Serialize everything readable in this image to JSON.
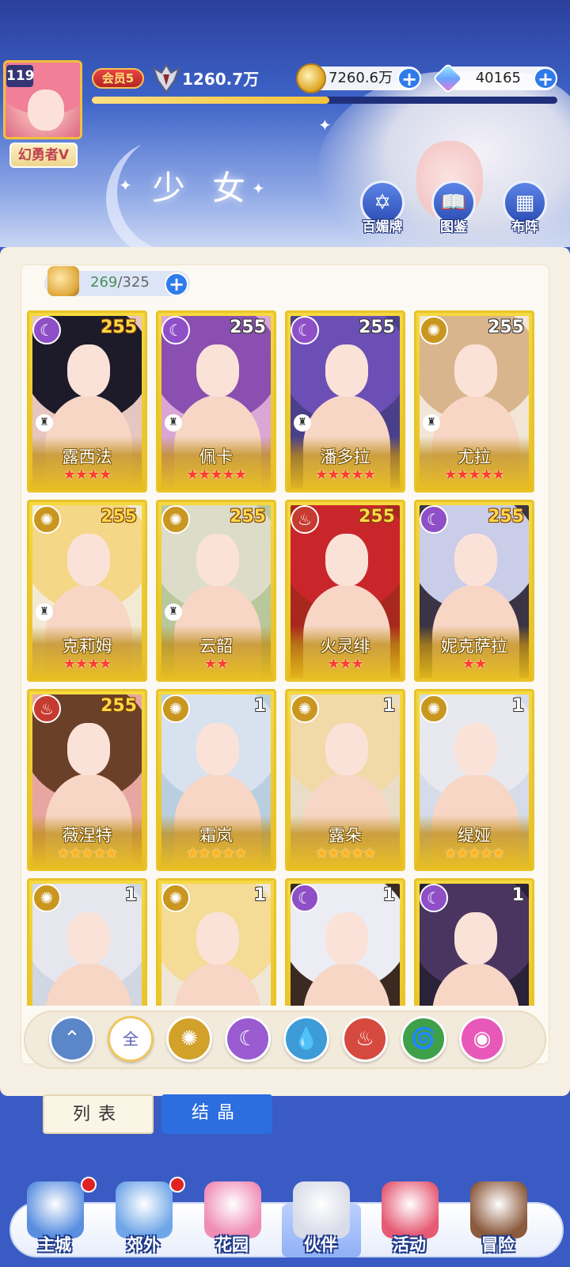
{
  "header": {
    "level": "119",
    "title_badge": "幻勇者V",
    "vip": "会员5",
    "power": "1260.7万",
    "exp_fraction": 0.51,
    "gold": "7260.6万",
    "gems": "40165",
    "page_title": "少女",
    "buttons": [
      {
        "label": "百媚牌",
        "icon": "card-icon"
      },
      {
        "label": "图鉴",
        "icon": "book-icon"
      },
      {
        "label": "布阵",
        "icon": "grid-icon"
      }
    ]
  },
  "roster": {
    "count": "269",
    "total": "/325",
    "cards": [
      {
        "name": "露西法",
        "level": "255",
        "element": "moon",
        "stars": "★★★★",
        "star_color": "red",
        "max": true,
        "rook": true,
        "hair": "#1d1a2a",
        "bg": "#e6c6c0"
      },
      {
        "name": "佩卡",
        "level": "255",
        "element": "moon",
        "stars": "★★★★★",
        "star_color": "red",
        "max": false,
        "rook": true,
        "hair": "#8a4fb0",
        "bg": "#d9a6d6"
      },
      {
        "name": "潘多拉",
        "level": "255",
        "element": "moon",
        "stars": "★★★★★",
        "star_color": "red",
        "max": false,
        "rook": true,
        "hair": "#6b4fb5",
        "bg": "#4a3f8a"
      },
      {
        "name": "尤拉",
        "level": "255",
        "element": "sun",
        "stars": "★★★★★",
        "star_color": "red",
        "max": false,
        "rook": true,
        "hair": "#d8b58c",
        "bg": "#f1e6d8"
      },
      {
        "name": "克莉姆",
        "level": "255",
        "element": "sun",
        "stars": "★★★★",
        "star_color": "red",
        "max": true,
        "rook": true,
        "hair": "#f4d787",
        "bg": "#f3ead6"
      },
      {
        "name": "云韶",
        "level": "255",
        "element": "sun",
        "stars": "★★",
        "star_color": "red",
        "max": true,
        "rook": true,
        "hair": "#dcdcc8",
        "bg": "#b8c79c"
      },
      {
        "name": "火灵绯",
        "level": "255",
        "element": "fire",
        "stars": "★★★",
        "star_color": "red",
        "max": true,
        "rook": false,
        "hair": "#c9262b",
        "bg": "#a8271e"
      },
      {
        "name": "妮克萨拉",
        "level": "255",
        "element": "moon",
        "stars": "★★",
        "star_color": "red",
        "max": true,
        "rook": false,
        "hair": "#c9cde8",
        "bg": "#3a3445"
      },
      {
        "name": "薇涅特",
        "level": "255",
        "element": "fire",
        "stars": "★★★★★",
        "star_color": "gold",
        "max": true,
        "rook": false,
        "hair": "#6b4028",
        "bg": "#e8a6a2"
      },
      {
        "name": "霜岚",
        "level": "1",
        "element": "sun",
        "stars": "★★★★★",
        "star_color": "gold",
        "max": false,
        "rook": false,
        "hair": "#d8e2ef",
        "bg": "#b9cfe0"
      },
      {
        "name": "露朵",
        "level": "1",
        "element": "sun",
        "stars": "★★★★★",
        "star_color": "gold",
        "max": false,
        "rook": false,
        "hair": "#f2d9a8",
        "bg": "#eaddc8"
      },
      {
        "name": "缇娅",
        "level": "1",
        "element": "sun",
        "stars": "★★★★★",
        "star_color": "gold",
        "max": false,
        "rook": false,
        "hair": "#e8e8ef",
        "bg": "#d5dbe8"
      },
      {
        "name": "",
        "level": "1",
        "element": "sun",
        "stars": "",
        "star_color": "gold",
        "max": false,
        "rook": false,
        "hair": "#e6e6ee",
        "bg": "#d0d6e2"
      },
      {
        "name": "",
        "level": "1",
        "element": "sun",
        "stars": "",
        "star_color": "gold",
        "max": false,
        "rook": false,
        "hair": "#f4db96",
        "bg": "#f0e6d6"
      },
      {
        "name": "",
        "level": "1",
        "element": "moon",
        "stars": "",
        "star_color": "gold",
        "max": false,
        "rook": false,
        "hair": "#ececf4",
        "bg": "#3a2a22"
      },
      {
        "name": "",
        "level": "1",
        "element": "moon",
        "stars": "",
        "star_color": "gold",
        "max": false,
        "rook": false,
        "hair": "#4a3560",
        "bg": "#2a2238"
      }
    ]
  },
  "filters": [
    {
      "id": "wing",
      "glyph": "⌃",
      "color": "#5b86c8"
    },
    {
      "id": "all",
      "glyph": "全",
      "color": "#ffffff"
    },
    {
      "id": "sun",
      "glyph": "✺",
      "color": "#d1a12a"
    },
    {
      "id": "moon",
      "glyph": "☾",
      "color": "#9a5bd0"
    },
    {
      "id": "water",
      "glyph": "💧",
      "color": "#3d9bd8"
    },
    {
      "id": "fire",
      "glyph": "♨",
      "color": "#d6493e"
    },
    {
      "id": "wind",
      "glyph": "🌀",
      "color": "#3fa04a"
    },
    {
      "id": "charm",
      "glyph": "◉",
      "color": "#e858b8"
    }
  ],
  "tabs": {
    "list": "列表",
    "crystal": "结晶"
  },
  "nav": [
    {
      "label": "主城",
      "color": "#5a8fe0",
      "badge": true
    },
    {
      "label": "郊外",
      "color": "#6fa6e8",
      "badge": true
    },
    {
      "label": "花园",
      "color": "#f08cb6",
      "badge": false
    },
    {
      "label": "伙伴",
      "color": "#d8dbe8",
      "badge": false
    },
    {
      "label": "活动",
      "color": "#e65a74",
      "badge": false
    },
    {
      "label": "冒险",
      "color": "#8c5a3c",
      "badge": false
    }
  ]
}
